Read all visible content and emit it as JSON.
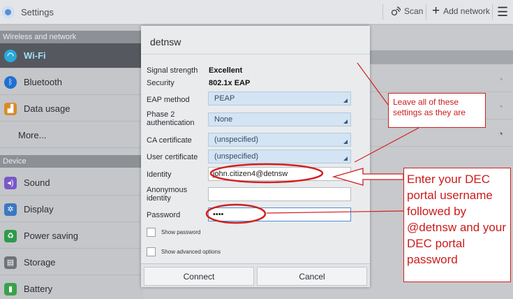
{
  "topbar": {
    "title": "Settings",
    "scan_label": "Scan",
    "add_label": "Add network"
  },
  "sidebar": {
    "sections": [
      "Wireless and network",
      "Device"
    ],
    "items": [
      {
        "label": "Wi-Fi",
        "icon": "wifi-icon"
      },
      {
        "label": "Bluetooth",
        "icon": "bluetooth-icon"
      },
      {
        "label": "Data usage",
        "icon": "data-usage-icon"
      },
      {
        "label": "More..."
      },
      {
        "label": "Sound",
        "icon": "sound-icon"
      },
      {
        "label": "Display",
        "icon": "display-icon"
      },
      {
        "label": "Power saving",
        "icon": "power-saving-icon"
      },
      {
        "label": "Storage",
        "icon": "storage-icon"
      },
      {
        "label": "Battery",
        "icon": "battery-icon"
      }
    ]
  },
  "dialog": {
    "title": "detnsw",
    "signal_label": "Signal strength",
    "signal_value": "Excellent",
    "security_label": "Security",
    "security_value": "802.1x EAP",
    "eap_label": "EAP method",
    "eap_value": "PEAP",
    "phase2_label_1": "Phase 2",
    "phase2_label_2": "authentication",
    "phase2_value": "None",
    "ca_label": "CA certificate",
    "ca_value": "(unspecified)",
    "user_cert_label": "User certificate",
    "user_cert_value": "(unspecified)",
    "identity_label": "Identity",
    "identity_value": "john.citizen4@detnsw",
    "anon_label_1": "Anonymous",
    "anon_label_2": "identity",
    "anon_value": "",
    "password_label": "Password",
    "password_value": "••••",
    "show_password_label": "Show password",
    "show_advanced_label": "Show advanced options",
    "connect_label": "Connect",
    "cancel_label": "Cancel"
  },
  "annotations": {
    "callout_settings": "Leave all of these settings as they are",
    "callout_credentials": "Enter your DEC portal username followed by @detnsw and your DEC portal password",
    "color": "#d21f1f"
  }
}
